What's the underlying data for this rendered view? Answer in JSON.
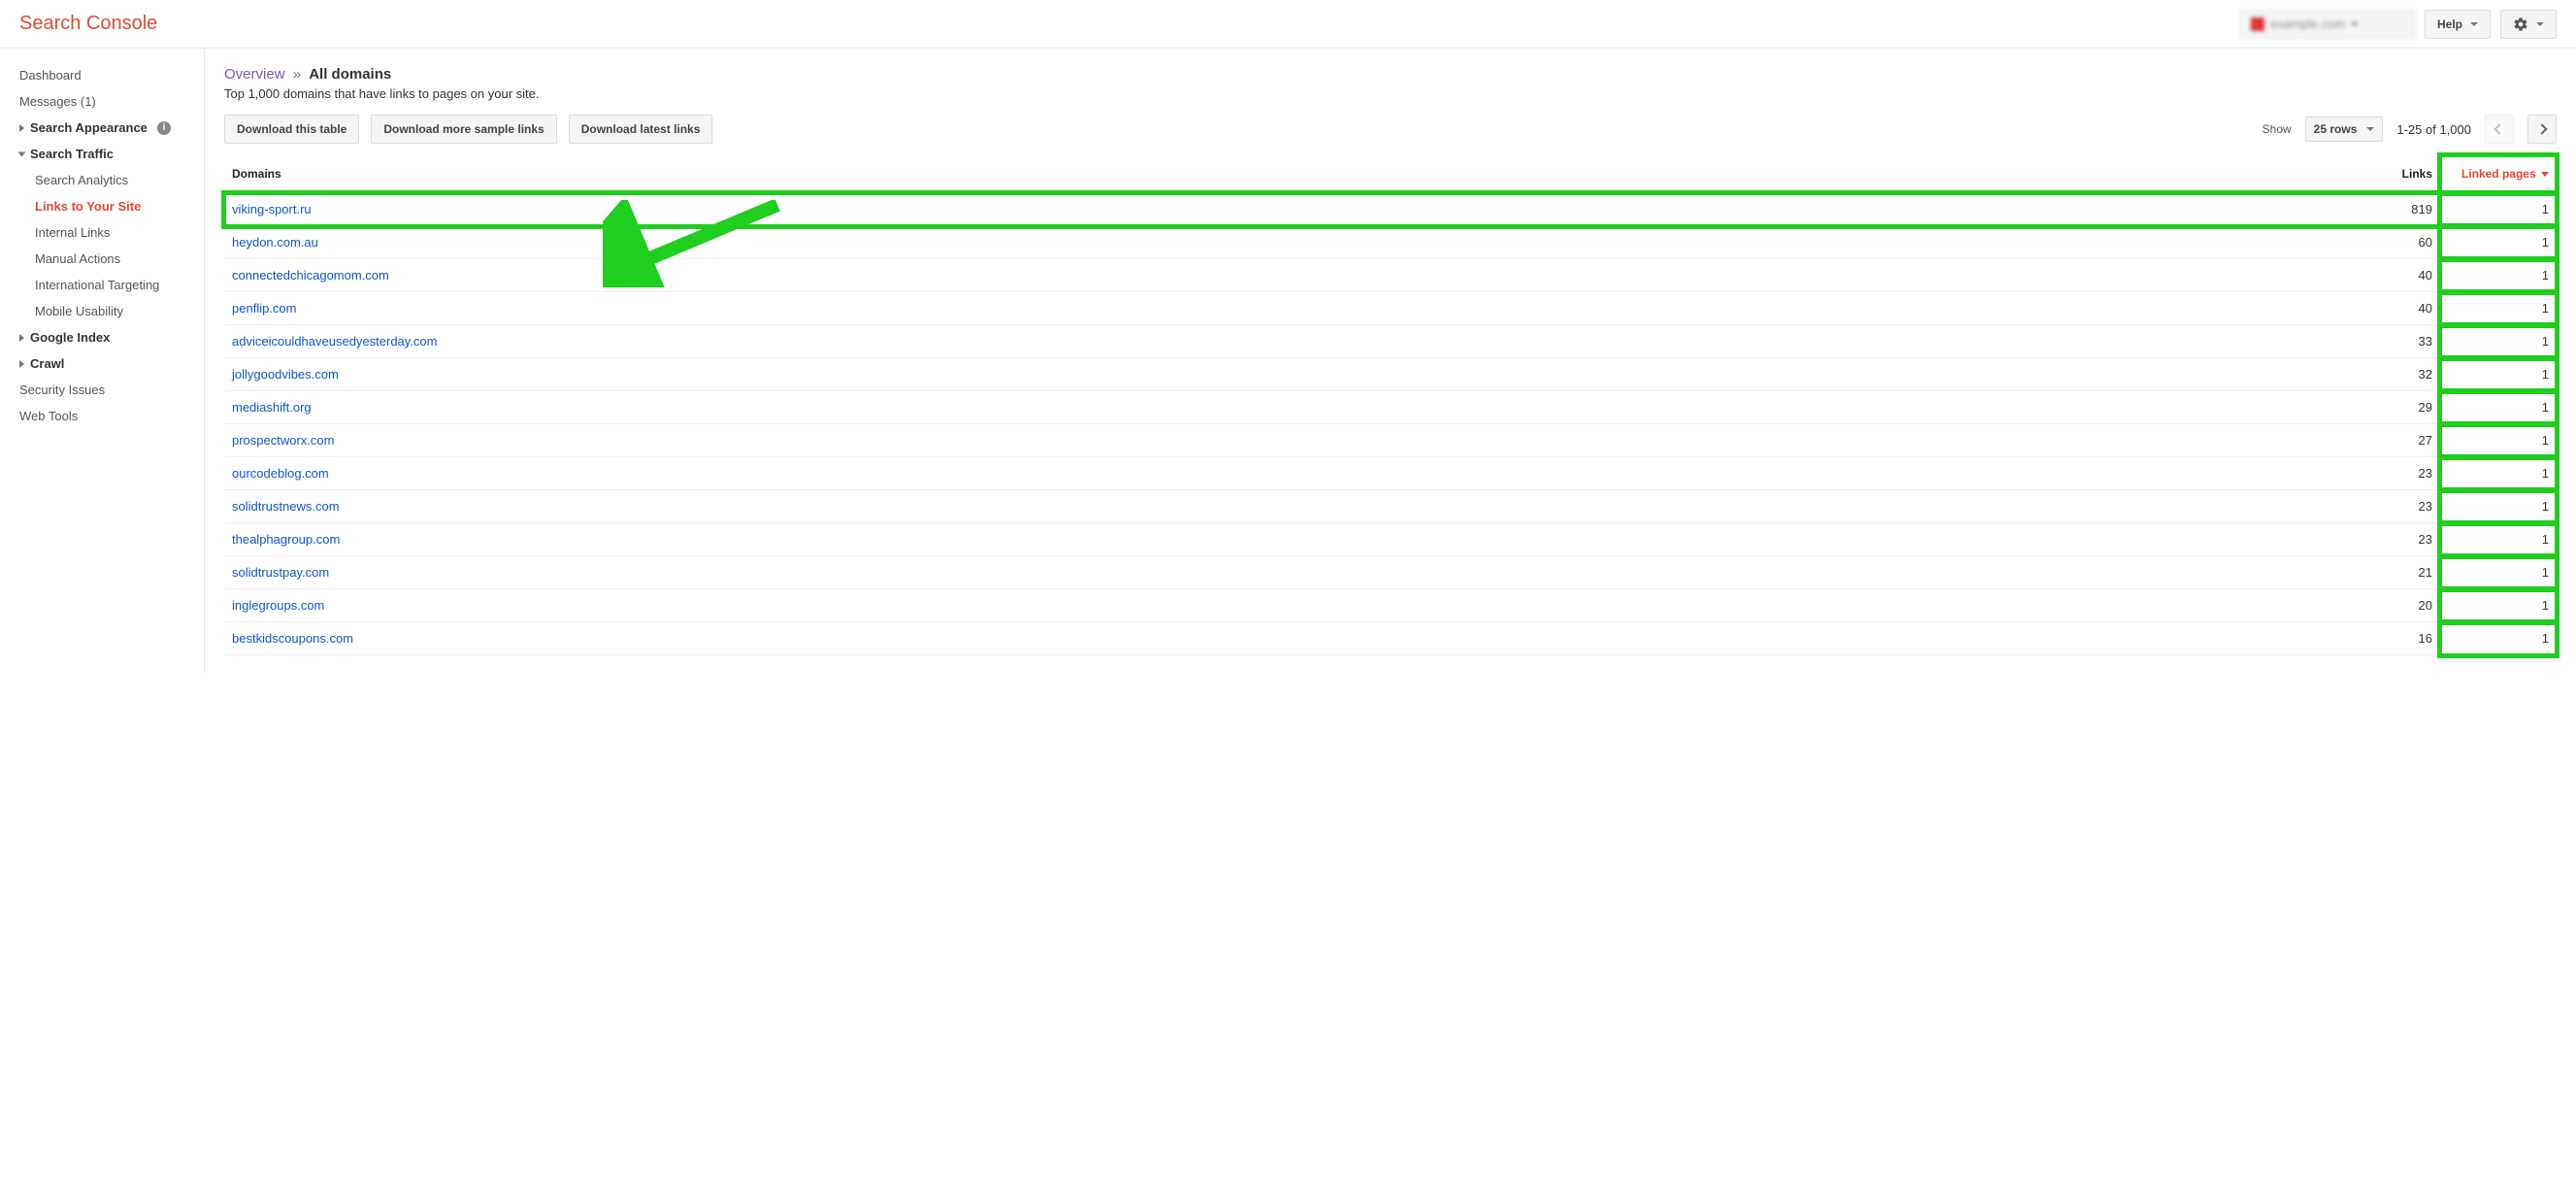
{
  "header": {
    "title": "Search Console",
    "property_text": "example.com",
    "help_label": "Help"
  },
  "sidebar": {
    "items": [
      {
        "label": "Dashboard",
        "type": "link"
      },
      {
        "label": "Messages (1)",
        "type": "link"
      },
      {
        "label": "Search Appearance",
        "type": "group",
        "arrow": "right",
        "info": true
      },
      {
        "label": "Search Traffic",
        "type": "group",
        "arrow": "down"
      },
      {
        "label": "Search Analytics",
        "type": "sub"
      },
      {
        "label": "Links to Your Site",
        "type": "sub",
        "active": true
      },
      {
        "label": "Internal Links",
        "type": "sub"
      },
      {
        "label": "Manual Actions",
        "type": "sub"
      },
      {
        "label": "International Targeting",
        "type": "sub"
      },
      {
        "label": "Mobile Usability",
        "type": "sub"
      },
      {
        "label": "Google Index",
        "type": "group",
        "arrow": "right"
      },
      {
        "label": "Crawl",
        "type": "group",
        "arrow": "right"
      },
      {
        "label": "Security Issues",
        "type": "link"
      },
      {
        "label": "Web Tools",
        "type": "link"
      }
    ]
  },
  "breadcrumb": {
    "overview_label": "Overview",
    "sep": "»",
    "current": "All domains"
  },
  "subtitle": "Top 1,000 domains that have links to pages on your site.",
  "actions": {
    "download_table": "Download this table",
    "download_more": "Download more sample links",
    "download_latest": "Download latest links"
  },
  "pagination": {
    "show_label": "Show",
    "rows_value": "25 rows",
    "range_text": "1-25 of 1,000"
  },
  "table": {
    "headers": {
      "domains": "Domains",
      "links": "Links",
      "linked_pages": "Linked pages"
    },
    "rows": [
      {
        "domain": "viking-sport.ru",
        "links": "819",
        "linked_pages": "1",
        "hl": true
      },
      {
        "domain": "heydon.com.au",
        "links": "60",
        "linked_pages": "1"
      },
      {
        "domain": "connectedchicagomom.com",
        "links": "40",
        "linked_pages": "1"
      },
      {
        "domain": "penflip.com",
        "links": "40",
        "linked_pages": "1"
      },
      {
        "domain": "adviceicouldhaveusedyesterday.com",
        "links": "33",
        "linked_pages": "1"
      },
      {
        "domain": "jollygoodvibes.com",
        "links": "32",
        "linked_pages": "1"
      },
      {
        "domain": "mediashift.org",
        "links": "29",
        "linked_pages": "1"
      },
      {
        "domain": "prospectworx.com",
        "links": "27",
        "linked_pages": "1"
      },
      {
        "domain": "ourcodeblog.com",
        "links": "23",
        "linked_pages": "1"
      },
      {
        "domain": "solidtrustnews.com",
        "links": "23",
        "linked_pages": "1"
      },
      {
        "domain": "thealphagroup.com",
        "links": "23",
        "linked_pages": "1"
      },
      {
        "domain": "solidtrustpay.com",
        "links": "21",
        "linked_pages": "1"
      },
      {
        "domain": "inglegroups.com",
        "links": "20",
        "linked_pages": "1"
      },
      {
        "domain": "bestkidscoupons.com",
        "links": "16",
        "linked_pages": "1"
      }
    ]
  }
}
